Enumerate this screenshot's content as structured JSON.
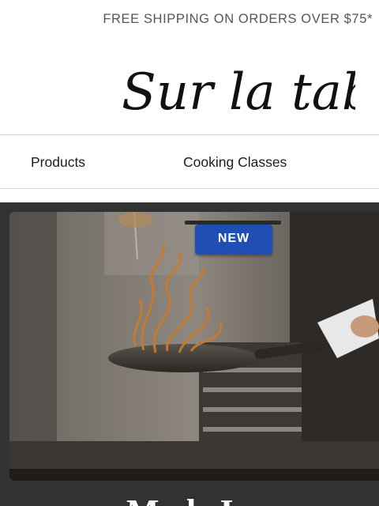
{
  "promo": {
    "text": "FREE SHIPPING ON ORDERS OVER $75*"
  },
  "brand": {
    "logo_text": "Sur la table"
  },
  "nav": {
    "items": [
      {
        "label": "Products"
      },
      {
        "label": "Cooking Classes"
      }
    ]
  },
  "hero": {
    "badge": "NEW",
    "title": "Made In",
    "image_subject": "chef tossing pasta in a frying pan",
    "colors": {
      "frame": "#323232",
      "badge": "#1f4fb4"
    }
  }
}
